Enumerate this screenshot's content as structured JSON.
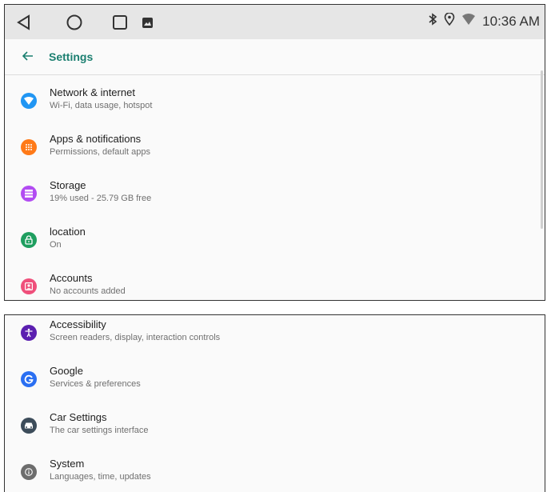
{
  "status_bar": {
    "time": "10:36 AM"
  },
  "app_bar": {
    "title": "Settings"
  },
  "top_items": [
    {
      "title": "Network & internet",
      "subtitle": "Wi-Fi, data usage, hotspot",
      "icon": "wifi-icon",
      "color": "#2196f3"
    },
    {
      "title": "Apps & notifications",
      "subtitle": "Permissions, default apps",
      "icon": "apps-grid-icon",
      "color": "#ff7a18"
    },
    {
      "title": "Storage",
      "subtitle": "19% used - 25.79 GB free",
      "icon": "storage-icon",
      "color": "#b24cf2"
    },
    {
      "title": "location",
      "subtitle": "On",
      "icon": "lock-icon",
      "color": "#1e9e5f"
    },
    {
      "title": "Accounts",
      "subtitle": "No accounts added",
      "icon": "account-icon",
      "color": "#ef4f7b"
    }
  ],
  "bottom_items": [
    {
      "title": "Accessibility",
      "subtitle": "Screen readers, display, interaction controls",
      "icon": "accessibility-icon",
      "color": "#5b1fb0"
    },
    {
      "title": "Google",
      "subtitle": "Services & preferences",
      "icon": "google-icon",
      "color": "#2a6ff2"
    },
    {
      "title": "Car Settings",
      "subtitle": "The car settings interface",
      "icon": "car-icon",
      "color": "#3c4c5a"
    },
    {
      "title": "System",
      "subtitle": "Languages, time, updates",
      "icon": "info-icon",
      "color": "#6d6d6d"
    }
  ]
}
